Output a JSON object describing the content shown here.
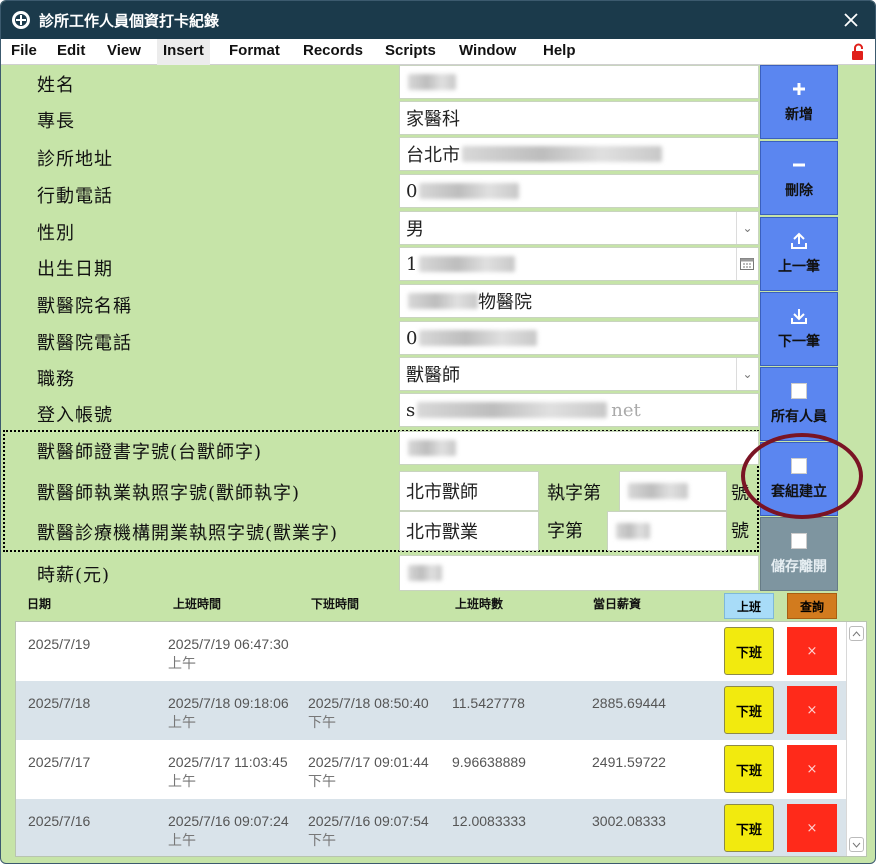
{
  "window": {
    "title": "診所工作人員個資打卡紀錄"
  },
  "menu": {
    "items": [
      "File",
      "Edit",
      "View",
      "Insert",
      "Format",
      "Records",
      "Scripts",
      "Window",
      "Help"
    ],
    "active": "Insert"
  },
  "form": {
    "labels": {
      "name": "姓名",
      "specialty": "專長",
      "clinic_address": "診所地址",
      "mobile": "行動電話",
      "gender": "性別",
      "birthdate": "出生日期",
      "hospital_name": "獸醫院名稱",
      "hospital_phone": "獸醫院電話",
      "position": "職務",
      "login_account": "登入帳號",
      "cert_no": "獸醫師證書字號(台獸師字)",
      "license_no": "獸醫師執業執照字號(獸師執字)",
      "clinic_license_no": "獸醫診療機構開業執照字號(獸業字)",
      "hourly_wage": "時薪(元)"
    },
    "values": {
      "name": "",
      "specialty": "家醫科",
      "clinic_address": "台北市",
      "mobile": "0",
      "gender": "男",
      "birthdate": "1",
      "hospital_name": "物醫院",
      "hospital_phone": "0",
      "position": "獸醫師",
      "login_account": "s",
      "login_account_tail": "net",
      "cert_no": "",
      "license_prefix": "北市獸師",
      "license_mid_label": "執字第",
      "license_suffix_label": "號",
      "clinic_license_prefix": "北市獸業",
      "clinic_license_mid_label": "字第",
      "clinic_license_suffix_label": "號",
      "hourly_wage": ""
    }
  },
  "side_buttons": [
    {
      "label": "新增",
      "icon": "plus-icon"
    },
    {
      "label": "刪除",
      "icon": "minus-icon"
    },
    {
      "label": "上一筆",
      "icon": "upload-icon"
    },
    {
      "label": "下一筆",
      "icon": "download-icon"
    },
    {
      "label": "所有人員",
      "icon": "square-icon"
    },
    {
      "label": "套組建立",
      "icon": "square-icon"
    },
    {
      "label": "儲存離開",
      "icon": "square-icon"
    }
  ],
  "table": {
    "headers": [
      "日期",
      "上班時間",
      "下班時間",
      "上班時數",
      "當日薪資"
    ],
    "clock_in_button": "上班",
    "query_button": "查詢",
    "clock_out_label": "下班",
    "delete_label": "×",
    "rows": [
      {
        "date": "2025/7/19",
        "in": "2025/7/19 06:47:30",
        "in_ampm": "上午",
        "out": "",
        "out_ampm": "",
        "hours": "",
        "pay": ""
      },
      {
        "date": "2025/7/18",
        "in": "2025/7/18 09:18:06",
        "in_ampm": "上午",
        "out": "2025/7/18 08:50:40",
        "out_ampm": "下午",
        "hours": "11.5427778",
        "pay": "2885.69444"
      },
      {
        "date": "2025/7/17",
        "in": "2025/7/17 11:03:45",
        "in_ampm": "上午",
        "out": "2025/7/17 09:01:44",
        "out_ampm": "下午",
        "hours": "9.96638889",
        "pay": "2491.59722"
      },
      {
        "date": "2025/7/16",
        "in": "2025/7/16 09:07:24",
        "in_ampm": "上午",
        "out": "2025/7/16 09:07:54",
        "out_ampm": "下午",
        "hours": "12.0083333",
        "pay": "3002.08333"
      }
    ]
  },
  "colors": {
    "titlebar": "#1b3a4b",
    "form_bg": "#c6e4a8",
    "side_button": "#5b86f0",
    "clock_out_button": "#f2ea0e",
    "delete_button": "#ff2a1a",
    "annotation_circle": "#7a1424"
  }
}
